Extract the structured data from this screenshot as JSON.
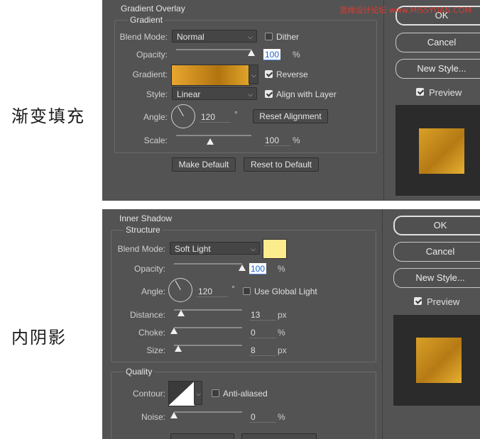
{
  "side_labels": {
    "top": "渐变填充",
    "bottom": "内阴影"
  },
  "watermark": "思缘设计论坛 www.MISSYUAN.COM",
  "gradient_overlay": {
    "title": "Gradient Overlay",
    "section": "Gradient",
    "blend_mode_label": "Blend Mode:",
    "blend_mode_value": "Normal",
    "dither_label": "Dither",
    "dither_checked": false,
    "opacity_label": "Opacity:",
    "opacity_value": "100",
    "opacity_unit": "%",
    "opacity_fraction": 1.0,
    "gradient_label": "Gradient:",
    "reverse_label": "Reverse",
    "reverse_checked": true,
    "style_label": "Style:",
    "style_value": "Linear",
    "align_label": "Align with Layer",
    "align_checked": true,
    "angle_label": "Angle:",
    "angle_value": "120",
    "angle_unit": "°",
    "reset_alignment": "Reset Alignment",
    "scale_label": "Scale:",
    "scale_value": "100",
    "scale_unit": "%",
    "scale_fraction": 0.45,
    "make_default": "Make Default",
    "reset_default": "Reset to Default",
    "ok": "OK",
    "cancel": "Cancel",
    "new_style": "New Style...",
    "preview_label": "Preview",
    "preview_checked": true,
    "gradient_colors": [
      "#e8a630",
      "#b2740f",
      "#e0a52a"
    ]
  },
  "inner_shadow": {
    "title": "Inner Shadow",
    "section": "Structure",
    "blend_mode_label": "Blend Mode:",
    "blend_mode_value": "Soft Light",
    "shadow_color": "#fdec8e",
    "opacity_label": "Opacity:",
    "opacity_value": "100",
    "opacity_unit": "%",
    "opacity_fraction": 1.0,
    "angle_label": "Angle:",
    "angle_value": "120",
    "angle_unit": "°",
    "global_light_label": "Use Global Light",
    "global_light_checked": false,
    "distance_label": "Distance:",
    "distance_value": "13",
    "distance_unit": "px",
    "distance_fraction": 0.1,
    "choke_label": "Choke:",
    "choke_value": "0",
    "choke_unit": "%",
    "choke_fraction": 0.0,
    "size_label": "Size:",
    "size_value": "8",
    "size_unit": "px",
    "size_fraction": 0.06,
    "quality_section": "Quality",
    "contour_label": "Contour:",
    "anti_aliased_label": "Anti-aliased",
    "anti_aliased_checked": false,
    "noise_label": "Noise:",
    "noise_value": "0",
    "noise_unit": "%",
    "noise_fraction": 0.0,
    "ok": "OK",
    "cancel": "Cancel",
    "new_style": "New Style...",
    "preview_label": "Preview",
    "preview_checked": true
  }
}
